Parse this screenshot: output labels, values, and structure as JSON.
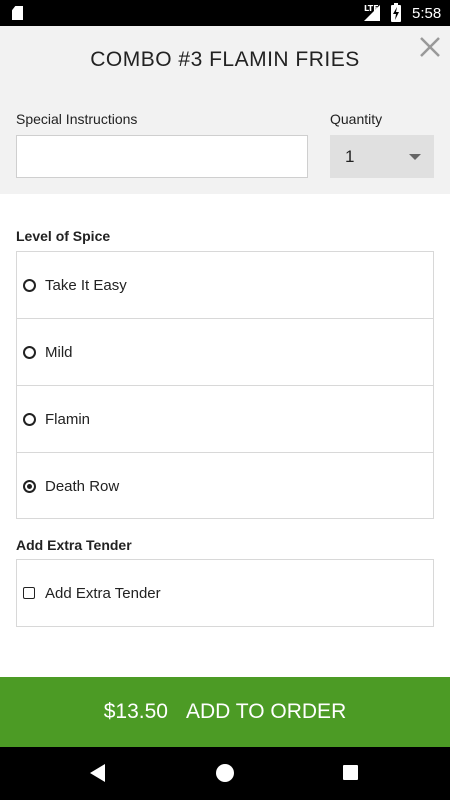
{
  "status_bar": {
    "network": "LTE",
    "time": "5:58",
    "icons": [
      "sd-card-icon",
      "signal-icon",
      "battery-charging-icon"
    ]
  },
  "header": {
    "title": "COMBO #3 FLAMIN FRIES",
    "close_icon": "close-icon",
    "special_instructions": {
      "label": "Special Instructions",
      "value": "",
      "placeholder": ""
    },
    "quantity": {
      "label": "Quantity",
      "value": "1"
    }
  },
  "spice": {
    "title": "Level of Spice",
    "options": [
      {
        "label": "Take It Easy",
        "selected": false
      },
      {
        "label": "Mild",
        "selected": false
      },
      {
        "label": "Flamin",
        "selected": false
      },
      {
        "label": "Death Row",
        "selected": true
      }
    ]
  },
  "extra_tender": {
    "title": "Add Extra Tender",
    "option": {
      "label": "Add Extra Tender",
      "checked": false
    }
  },
  "order_button": {
    "price": "$13.50",
    "label": "ADD TO ORDER",
    "color": "#4c9b25"
  },
  "nav_bar": {
    "icons": [
      "back-icon",
      "home-icon",
      "recents-icon"
    ]
  }
}
